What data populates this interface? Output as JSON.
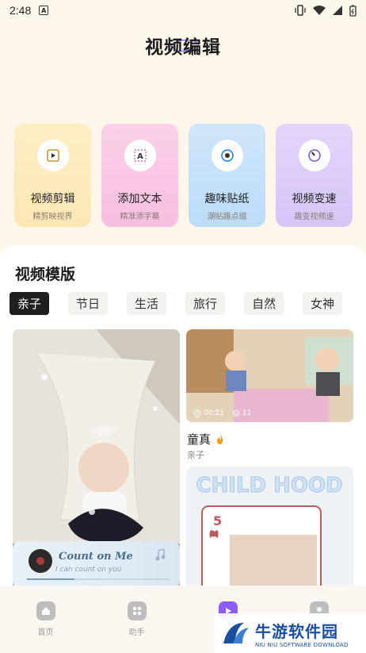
{
  "status": {
    "time": "2:48"
  },
  "page_title": "视频编辑",
  "tools": [
    {
      "name": "视频剪辑",
      "sub": "精剪映视界",
      "icon": "play-square-icon"
    },
    {
      "name": "添加文本",
      "sub": "精准添字幕",
      "icon": "text-a-icon"
    },
    {
      "name": "趣味贴纸",
      "sub": "潮贴趣点缀",
      "icon": "sticker-icon"
    },
    {
      "name": "视频变速",
      "sub": "趣变视频速",
      "icon": "speed-gauge-icon"
    }
  ],
  "section_title": "视频模版",
  "categories": [
    "亲子",
    "节日",
    "生活",
    "旅行",
    "自然",
    "女神"
  ],
  "active_category": "亲子",
  "template_right": {
    "duration": "00:21",
    "count": "11",
    "title": "童真",
    "sub": "亲子"
  },
  "music": {
    "title": "Count on Me",
    "lyric": "I can count on you"
  },
  "nav": [
    {
      "label": "首页",
      "icon": "home-icon"
    },
    {
      "label": "助手",
      "icon": "grid-icon"
    },
    {
      "label": "",
      "icon": "video-play-icon"
    },
    {
      "label": "",
      "icon": "profile-icon"
    }
  ],
  "watermark": {
    "cn": "牛游软件园",
    "en": "NIU NIU SOFTWARE DOWNLOAD"
  },
  "colors": {
    "accent": "#8b5cf6",
    "background": "#fdf6ea",
    "brand": "#1a4fa0"
  }
}
